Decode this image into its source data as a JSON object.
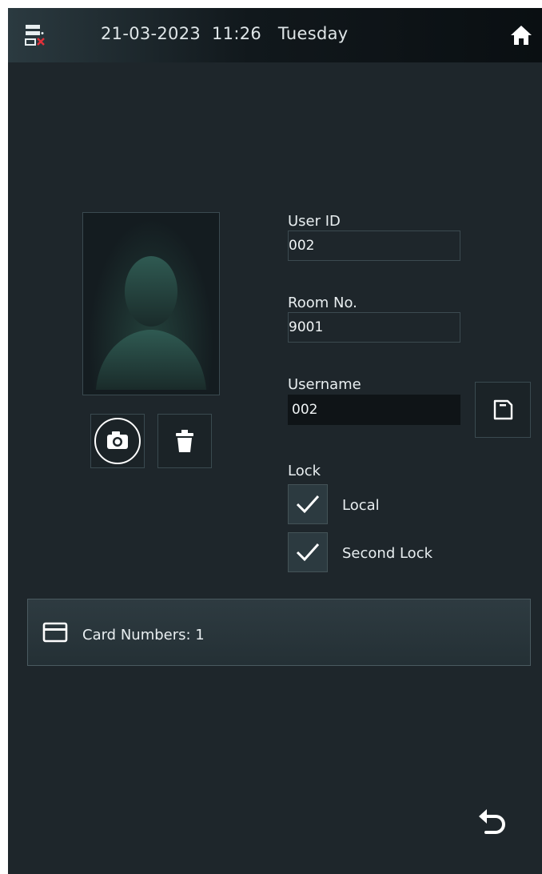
{
  "statusbar": {
    "datetime": "21-03-2023  11:26   Tuesday",
    "network_icon": "network-disconnected-icon",
    "home_icon": "home-icon"
  },
  "photo": {
    "capture_icon": "camera-icon",
    "delete_icon": "trash-icon"
  },
  "form": {
    "user_id_label": "User ID",
    "user_id_value": "002",
    "room_label": "Room No.",
    "room_value": "9001",
    "username_label": "Username",
    "username_value": "002",
    "save_icon": "save-icon"
  },
  "lock": {
    "label": "Lock",
    "options": [
      {
        "label": "Local",
        "checked": true
      },
      {
        "label": "Second Lock",
        "checked": true
      }
    ]
  },
  "card": {
    "label": "Card Numbers: 1",
    "icon": "card-icon"
  },
  "footer": {
    "back_icon": "back-icon"
  },
  "colors": {
    "background": "#1e262b",
    "statusbar": "#0a0f12",
    "accent_white": "#ffffff"
  }
}
